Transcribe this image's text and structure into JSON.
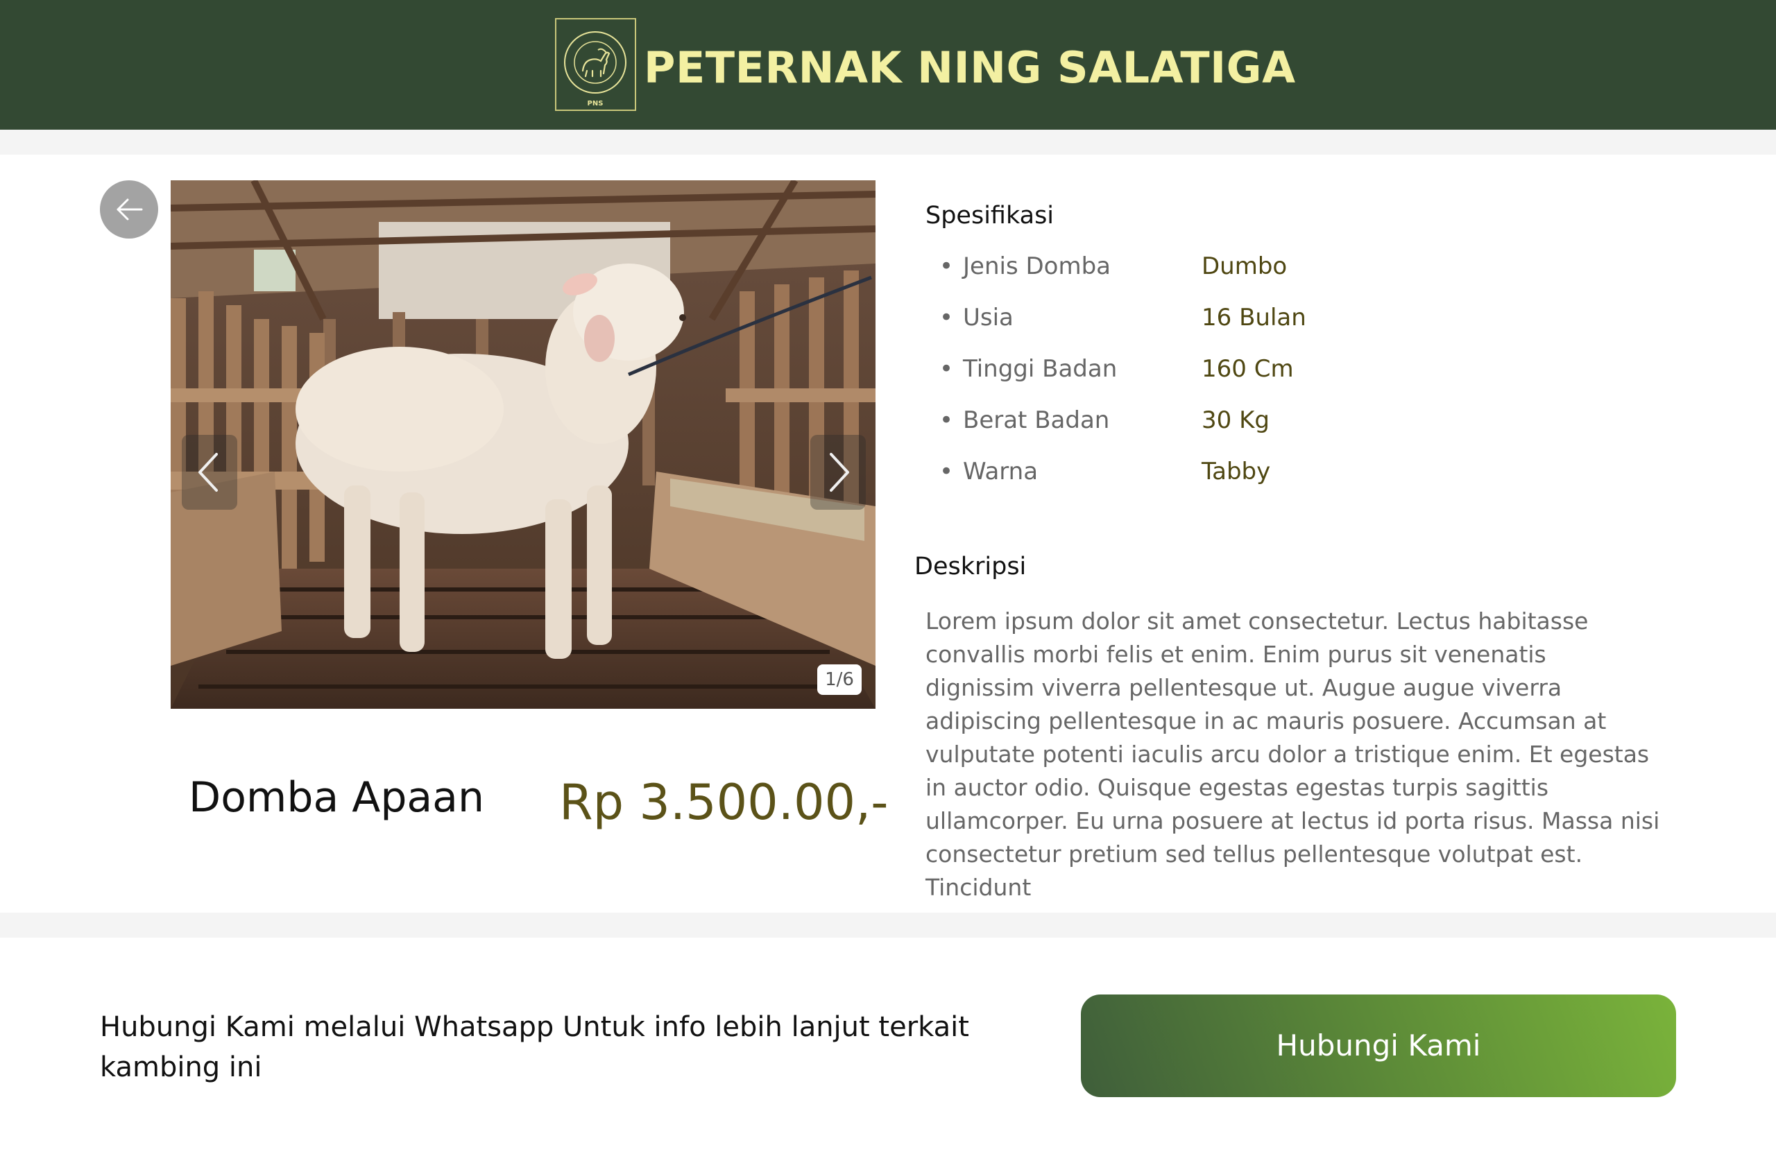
{
  "header": {
    "brand_name": "PETERNAK NING SALATIGA",
    "logo": {
      "ring_text": "Peternak Ning Salatiga",
      "initials": "PNS",
      "icon": "goat-logo-icon"
    },
    "background_color": "#334933",
    "brand_color": "#f3f0a2"
  },
  "gallery": {
    "current_index": 1,
    "total": 6,
    "counter_label": "1/6",
    "back_icon": "arrow-left-icon",
    "prev_icon": "chevron-left-icon",
    "next_icon": "chevron-right-icon"
  },
  "product": {
    "name": "Domba Apaan",
    "price": "Rp 3.500.00,-",
    "price_color": "#5b5218"
  },
  "specs": {
    "title": "Spesifikasi",
    "items": [
      {
        "label": "Jenis Domba",
        "value": "Dumbo"
      },
      {
        "label": "Usia",
        "value": "16 Bulan"
      },
      {
        "label": "Tinggi Badan",
        "value": "160 Cm"
      },
      {
        "label": "Berat Badan",
        "value": "30 Kg"
      },
      {
        "label": "Warna",
        "value": "Tabby"
      }
    ]
  },
  "description": {
    "title": "Deskripsi",
    "text": "Lorem ipsum dolor sit amet consectetur. Lectus habitasse convallis morbi felis et enim. Enim purus sit venenatis dignissim viverra pellentesque ut. Augue augue viverra adipiscing pellentesque in ac mauris posuere. Accumsan at vulputate potenti iaculis arcu dolor a tristique enim. Et egestas in auctor odio. Quisque egestas egestas turpis sagittis ullamcorper. Eu urna posuere at lectus id porta risus. Massa nisi consectetur pretium sed tellus pellentesque volutpat est. Tincidunt"
  },
  "cta": {
    "text": "Hubungi Kami melalui Whatsapp Untuk info lebih lanjut terkait kambing ini",
    "button_label": "Hubungi Kami",
    "button_colors": [
      "#7ab33a",
      "#3f5e3a"
    ]
  }
}
